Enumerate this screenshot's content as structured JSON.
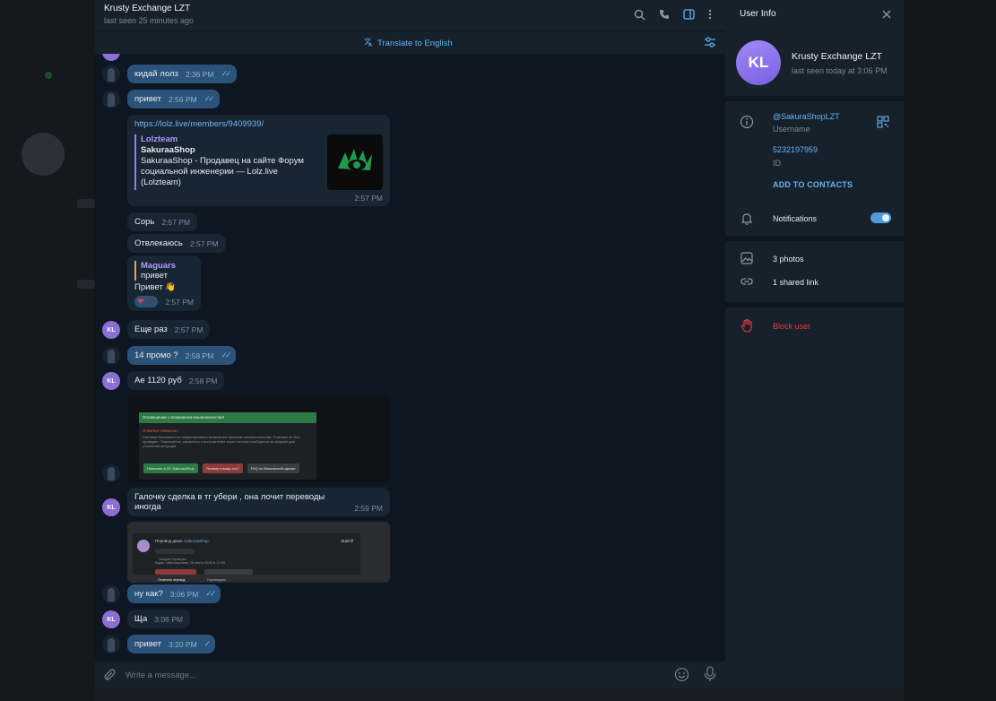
{
  "chat": {
    "title": "Krusty Exchange LZT",
    "status": "last seen 25 minutes ago",
    "translate_label": "Translate to English",
    "composer_placeholder": "Write a message..."
  },
  "messages": {
    "m1": {
      "text": "кидай лолз",
      "time": "2:36 PM",
      "check": "✓✓"
    },
    "m2": {
      "text": "привет",
      "time": "2:56 PM",
      "check": "✓✓"
    },
    "m3": {
      "url": "https://lolz.live/members/9409939/",
      "site": "Lolzteam",
      "title": "SakuraaShop",
      "desc": "SakuraaShop - Продавец на сайте Форум социальной инженерии — Lolz.live (Lolzteam)",
      "time": "2:57 PM"
    },
    "m4": {
      "text": "Сорь",
      "time": "2:57 PM"
    },
    "m5": {
      "text": "Отвлекаюсь",
      "time": "2:57 PM"
    },
    "m6": {
      "quote_author": "Maguars",
      "quote_text": "привет",
      "text": "Привет 👋",
      "reaction": "❤",
      "time": "2:57 PM"
    },
    "m7": {
      "text": "Еще раз",
      "time": "2:57 PM",
      "avatar": "KL"
    },
    "m8": {
      "text": "14 промо ?",
      "time": "2:58 PM",
      "check": "✓✓"
    },
    "m9": {
      "text": "Ае 1120 руб",
      "time": "2:58 PM",
      "avatar": "KL"
    },
    "m10": {
      "dialog_title": "Оповещение о возможном мошенничестве!",
      "warning": "Пометка «Опасно»",
      "body": "Система безопасности зафиксировала возможные признаки мошенничества. Платежи не был проведен. Пожалуйста, свяжитесь с получателем через личные сообщения на форуме для уточнения ситуации.",
      "btn1": "Написать в ЛС SakuraaShop",
      "btn2": "Почему я вижу это?",
      "btn3": "FAQ по безопасной сделке"
    },
    "m11": {
      "text": "Галочку сделка в тг убери , она лочит переводы иногда",
      "time": "2:59 PM",
      "avatar": "KL"
    },
    "m12": {
      "transfer_label": "Перевод денег",
      "transfer_user": "SakuraaShop",
      "amount": "1120 ₽",
      "status": "Ожидает проверки",
      "hold_text": "Будет заблокирован 26 июня 2025 в 12:00",
      "btn_red": "Отменить перевод",
      "btn_grey": "Подтвердить"
    },
    "m13": {
      "text": "ну как?",
      "time": "3:06 PM",
      "check": "✓✓"
    },
    "m14": {
      "text": "Ща",
      "time": "3:06 PM",
      "avatar": "KL"
    },
    "m15": {
      "text": "привет",
      "time": "3:20 PM",
      "check": "✓"
    }
  },
  "info": {
    "title": "User Info",
    "avatar_initials": "KL",
    "name": "Krusty Exchange LZT",
    "status": "last seen today at 3:06 PM",
    "username": "@SakuraShopLZT",
    "username_label": "Username",
    "id": "5232197959",
    "id_label": "ID",
    "add_contacts": "ADD TO CONTACTS",
    "notifications": "Notifications",
    "notifications_on": true,
    "photos": "3 photos",
    "links": "1 shared link",
    "block": "Block user"
  },
  "colors": {
    "accent": "#6ab2f2",
    "outgoing_bubble": "#2b5278",
    "incoming_bubble": "#182533",
    "danger": "#ec3942",
    "avatar": "#8a6fd6"
  }
}
